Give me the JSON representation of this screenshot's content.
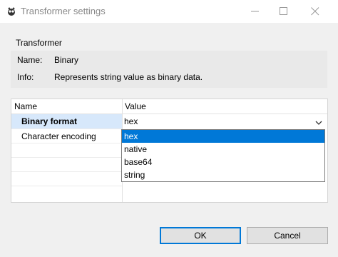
{
  "window": {
    "title": "Transformer settings",
    "controls": {
      "minimize": "minimize",
      "maximize": "maximize",
      "close": "close"
    }
  },
  "transformer": {
    "section_label": "Transformer",
    "name_key": "Name:",
    "name_value": "Binary",
    "info_key": "Info:",
    "info_value": "Represents string value as binary data."
  },
  "table": {
    "columns": [
      "Name",
      "Value"
    ],
    "rows": [
      {
        "name": "Binary format",
        "value": "hex",
        "selected": true
      },
      {
        "name": "Character encoding",
        "value": ""
      }
    ]
  },
  "dropdown": {
    "options": [
      "hex",
      "native",
      "base64",
      "string"
    ],
    "selected": "hex"
  },
  "buttons": {
    "ok": "OK",
    "cancel": "Cancel"
  },
  "colors": {
    "selection": "#0078d7",
    "row_highlight": "#d7e8fb",
    "button_face": "#e1e1e1"
  }
}
